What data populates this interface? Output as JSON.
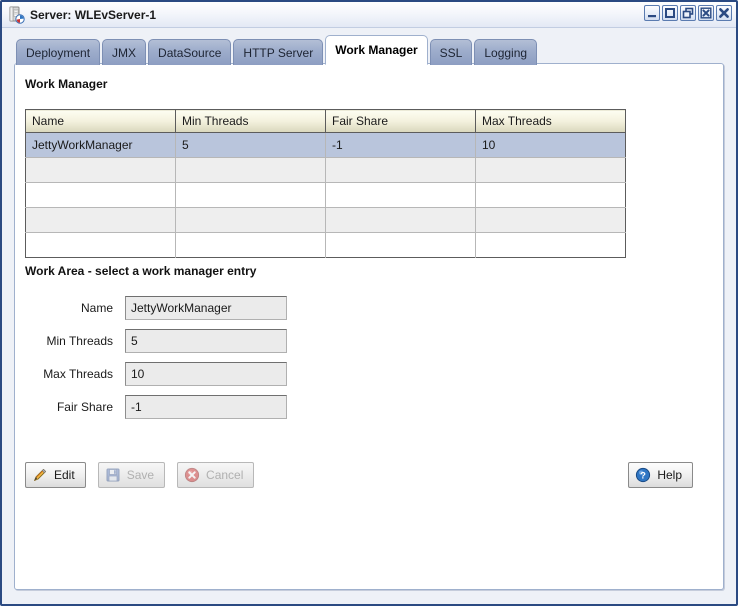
{
  "window": {
    "title": "Server: WLEvServer-1",
    "icon": "server-icon",
    "controls": [
      {
        "name": "minimize-button",
        "glyph": "minimize-icon"
      },
      {
        "name": "maximize-button",
        "glyph": "maximize-icon"
      },
      {
        "name": "restore-button",
        "glyph": "restore-icon"
      },
      {
        "name": "close-document-button",
        "glyph": "close-box-icon"
      },
      {
        "name": "close-button",
        "glyph": "close-icon"
      }
    ]
  },
  "tabs": [
    {
      "label": "Deployment",
      "active": false
    },
    {
      "label": "JMX",
      "active": false
    },
    {
      "label": "DataSource",
      "active": false
    },
    {
      "label": "HTTP Server",
      "active": false
    },
    {
      "label": "Work Manager",
      "active": true
    },
    {
      "label": "SSL",
      "active": false
    },
    {
      "label": "Logging",
      "active": false
    }
  ],
  "panel": {
    "work_manager_title": "Work Manager",
    "work_area_title": "Work Area - select a work manager entry"
  },
  "table": {
    "columns": [
      "Name",
      "Min Threads",
      "Fair Share",
      "Max Threads"
    ],
    "rows": [
      {
        "cells": [
          "JettyWorkManager",
          "5",
          "-1",
          "10"
        ],
        "selected": true
      },
      {
        "cells": [
          "",
          "",
          "",
          ""
        ],
        "selected": false
      },
      {
        "cells": [
          "",
          "",
          "",
          ""
        ],
        "selected": false
      },
      {
        "cells": [
          "",
          "",
          "",
          ""
        ],
        "selected": false
      },
      {
        "cells": [
          "",
          "",
          "",
          ""
        ],
        "selected": false
      }
    ]
  },
  "form": {
    "fields": [
      {
        "label": "Name",
        "value": "JettyWorkManager",
        "name": "name-field"
      },
      {
        "label": "Min Threads",
        "value": "5",
        "name": "min-threads-field"
      },
      {
        "label": "Max Threads",
        "value": "10",
        "name": "max-threads-field"
      },
      {
        "label": "Fair Share",
        "value": "-1",
        "name": "fair-share-field"
      }
    ]
  },
  "buttons": {
    "edit": "Edit",
    "save": "Save",
    "cancel": "Cancel",
    "help": "Help"
  },
  "colors": {
    "frame_border": "#2b4a82",
    "tab_inactive": "#9daccb",
    "tab_active": "#ffffff",
    "table_header": "#f3f1dd",
    "row_selected": "#b9c5dc",
    "row_alt": "#eeeeee",
    "input_disabled": "#ebebeb",
    "help_blue": "#2f76c4",
    "cancel_red": "#cc2222",
    "edit_orange": "#e8a33d"
  }
}
